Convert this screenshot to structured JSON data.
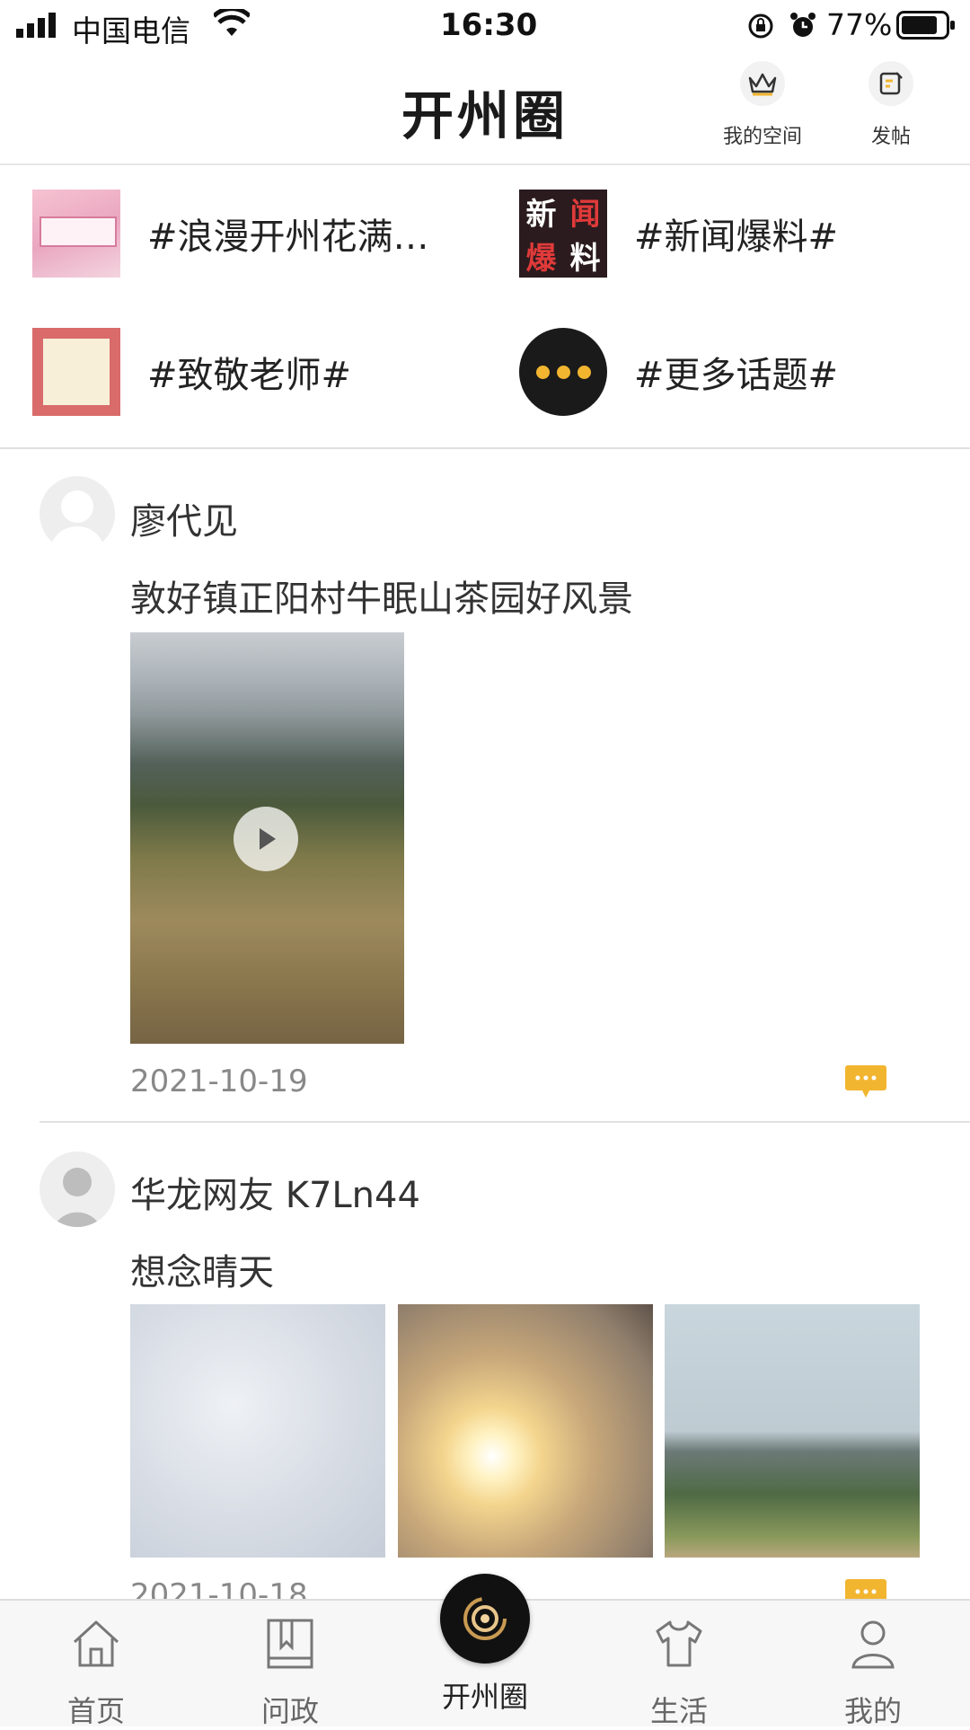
{
  "status_bar": {
    "carrier": "中国电信",
    "time": "16:30",
    "battery": "77%"
  },
  "header": {
    "title": "开州圈",
    "my_space_label": "我的空间",
    "post_label": "发帖"
  },
  "topics": [
    {
      "label": "#浪漫开州花满…",
      "icon": "flower-promo-thumbnail"
    },
    {
      "label": "#新闻爆料#",
      "icon": "news-tip-thumbnail",
      "thumb_text": [
        "新",
        "闻",
        "爆",
        "料"
      ]
    },
    {
      "label": "#致敬老师#",
      "icon": "teacher-tribute-thumbnail"
    },
    {
      "label": "#更多话题#",
      "icon": "more-dots-icon"
    }
  ],
  "posts": [
    {
      "user": "廖代见",
      "text": "敦好镇正阳村牛眠山茶园好风景",
      "media": "video",
      "date": "2021-10-19"
    },
    {
      "user": "华龙网友 K7Ln44",
      "text": "想念晴天",
      "media": "images",
      "image_count": 3,
      "date": "2021-10-18"
    }
  ],
  "tabbar": {
    "items": [
      {
        "label": "首页",
        "icon": "home-icon"
      },
      {
        "label": "问政",
        "icon": "book-icon"
      },
      {
        "label": "开州圈",
        "icon": "circle-icon",
        "active": true
      },
      {
        "label": "生活",
        "icon": "shirt-icon"
      },
      {
        "label": "我的",
        "icon": "person-icon"
      }
    ]
  },
  "colors": {
    "accent": "#f2b530",
    "title": "#1a1a1a",
    "muted": "#888888"
  }
}
